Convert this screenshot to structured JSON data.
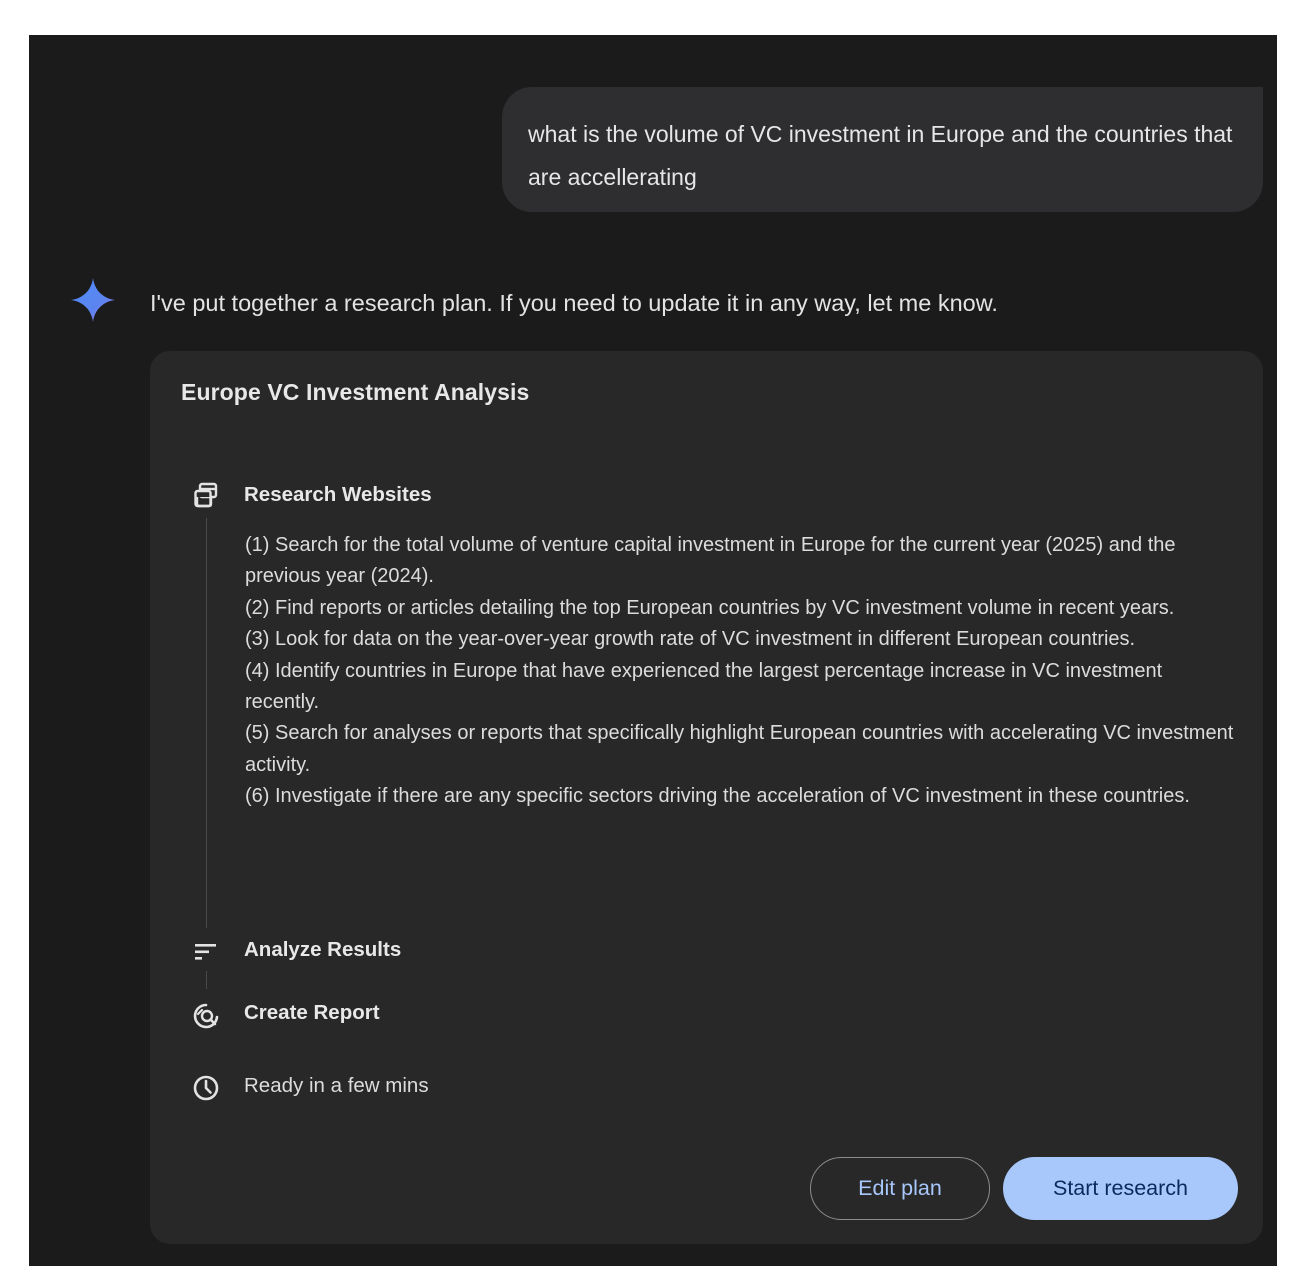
{
  "user_message": "what is the volume of VC investment in Europe and the countries that are accellerating",
  "assistant": {
    "intro": "I've put together a research plan. If you need to update it in any way, let me know."
  },
  "plan": {
    "title": "Europe VC Investment Analysis",
    "steps": {
      "research_websites": "Research Websites",
      "analyze_results": "Analyze Results",
      "create_report": "Create Report"
    },
    "research_items": [
      "(1) Search for the total volume of venture capital investment in Europe for the current year (2025) and the previous year (2024).",
      "(2) Find reports or articles detailing the top European countries by VC investment volume in recent years.",
      "(3) Look for data on the year-over-year growth rate of VC investment in different European countries.",
      "(4) Identify countries in Europe that have experienced the largest percentage increase in VC investment recently.",
      "(5) Search for analyses or reports that specifically highlight European countries with accelerating VC investment activity.",
      "(6) Investigate if there are any specific sectors driving the acceleration of VC investment in these countries."
    ],
    "eta": "Ready in a few mins",
    "edit_label": "Edit plan",
    "start_label": "Start research"
  },
  "icons": {
    "sparkle": "gemini-sparkle-icon",
    "research": "browser-windows-icon",
    "analyze": "sort-lines-icon",
    "report": "report-search-icon",
    "clock": "clock-icon"
  },
  "colors": {
    "background": "#1b1b1b",
    "card": "#282828",
    "user_bubble": "#2e2e31",
    "primary_button": "#a8c7fa",
    "link_text": "#a8c7fa"
  }
}
